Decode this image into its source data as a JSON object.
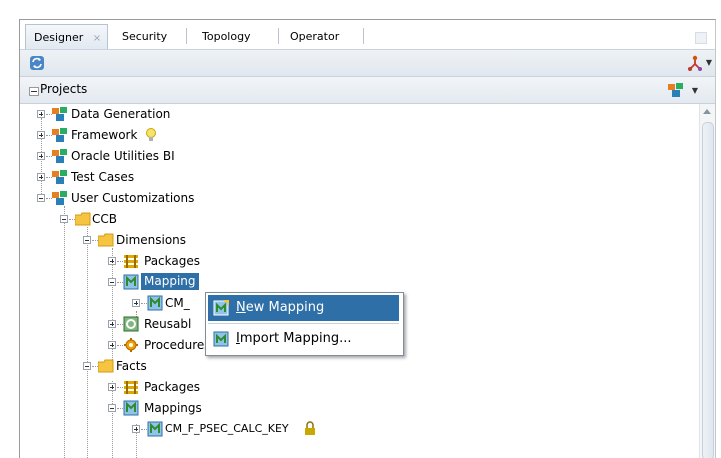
{
  "tabs": [
    {
      "label": "Designer",
      "close": "×"
    },
    {
      "label": "Security"
    },
    {
      "label": "Topology"
    },
    {
      "label": "Operator"
    }
  ],
  "panel": {
    "title": "Projects"
  },
  "tree": {
    "data_generation": "Data Generation",
    "framework": "Framework",
    "oracle_utilities_bi": "Oracle Utilities BI",
    "test_cases": "Test Cases",
    "user_customizations": "User Customizations",
    "ccb": "CCB",
    "dimensions": "Dimensions",
    "packages": "Packages",
    "mappings_partial": "Mapping",
    "cm_partial": "CM_",
    "reusable_partial": "Reusabl",
    "procedures": "Procedures",
    "facts": "Facts",
    "facts_packages": "Packages",
    "facts_mappings": "Mappings",
    "facts_mapping_child_partial": "CM_F_PSEC_CALC_KEY"
  },
  "context_menu": {
    "new_mapping_prefix": "",
    "new_mapping_mnemonic": "N",
    "new_mapping_rest": "ew Mapping",
    "import_mapping_mnemonic": "I",
    "import_mapping_rest": "mport Mapping..."
  },
  "icons": {
    "refresh": "sync-icon",
    "toolbar_tool": "model-tool-icon",
    "projects_menu": "projects-menu-icon",
    "project": "project-icon",
    "folder": "folder-icon",
    "package": "package-icon",
    "mapping": "mapping-icon",
    "procedure": "procedure-icon",
    "lightbulb": "lightbulb-icon"
  },
  "colors": {
    "selection": "#2f6fa8",
    "toolbar_bg": "#e6ecf2"
  }
}
